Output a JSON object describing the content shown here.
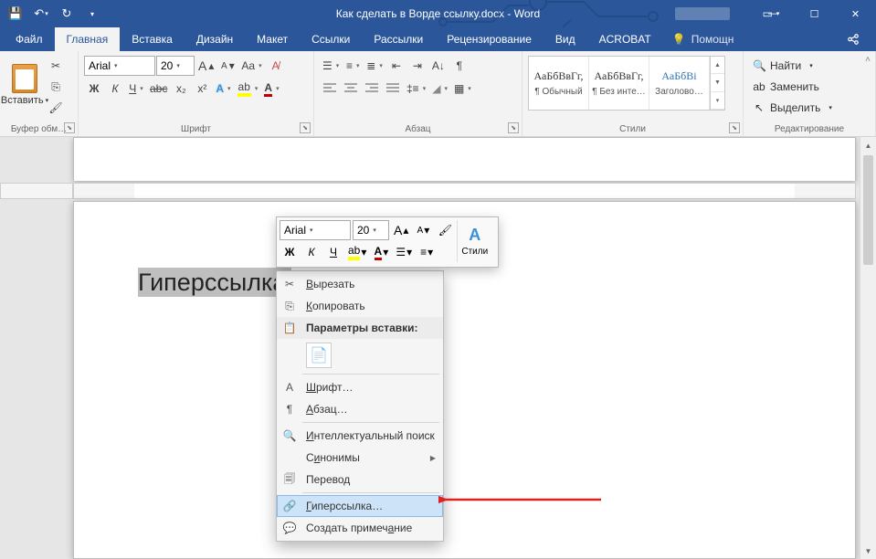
{
  "title": "Как сделать в Ворде ссылку.docx - Word",
  "tabs": {
    "file": "Файл",
    "home": "Главная",
    "insert": "Вставка",
    "design": "Дизайн",
    "layout": "Макет",
    "references": "Ссылки",
    "mailings": "Рассылки",
    "review": "Рецензирование",
    "view": "Вид",
    "acrobat": "ACROBAT",
    "tellme": "Помощн"
  },
  "ribbon": {
    "clipboard": {
      "label": "Буфер обм…",
      "paste": "Вставить"
    },
    "font": {
      "label": "Шрифт",
      "name": "Arial",
      "size": "20",
      "grow": "A",
      "shrink": "A",
      "case": "Aa",
      "bold": "Ж",
      "italic": "К",
      "underline": "Ч",
      "strike": "abc",
      "sub": "x₂",
      "sup": "x²"
    },
    "para": {
      "label": "Абзац"
    },
    "styles": {
      "label": "Стили",
      "preview": "АаБбВвГг,",
      "normal": "¶ Обычный",
      "nospacing": "¶ Без инте…",
      "heading1_prev": "АаБбВі",
      "heading1": "Заголово…"
    },
    "editing": {
      "label": "Редактирование",
      "find": "Найти",
      "replace": "Заменить",
      "select": "Выделить"
    }
  },
  "doc": {
    "selected_text": "Гиперссылка"
  },
  "minitb": {
    "font": "Arial",
    "size": "20",
    "styles_label": "Стили",
    "bold": "Ж",
    "italic": "К",
    "underline": "Ч"
  },
  "ctx": {
    "cut": "Вырезать",
    "copy": "Копировать",
    "paste_heading": "Параметры вставки:",
    "font": "Шрифт…",
    "para": "Абзац…",
    "smartlookup": "Интеллектуальный поиск",
    "synonyms": "Синонимы",
    "translate": "Перевод",
    "hyperlink": "Гиперссылка…",
    "comment": "Создать примечание"
  }
}
